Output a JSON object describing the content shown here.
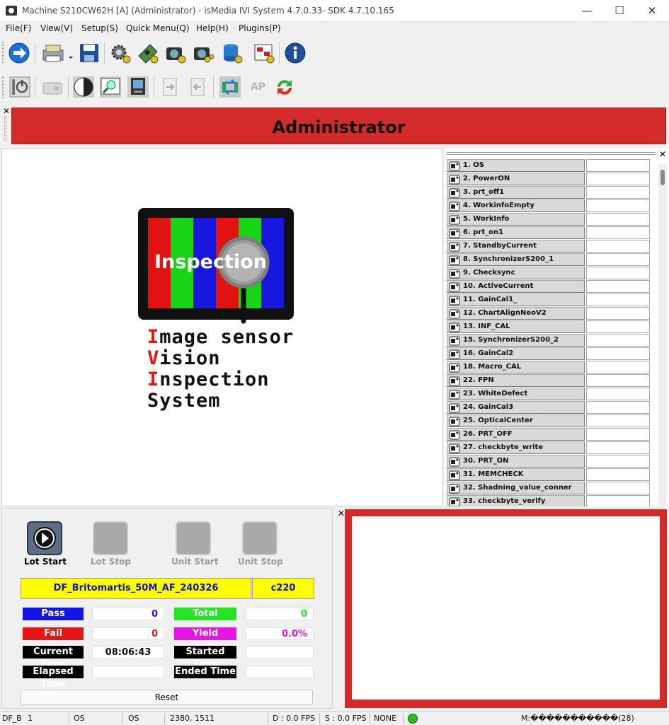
{
  "window": {
    "title": "Machine S210CW62H [A] (Administrator) - isMedia IVI System 4.7.0.33- SDK 4.7.10.165",
    "minimize": "—",
    "maximize": "☐",
    "close": "✕"
  },
  "menu": [
    "File(F)",
    "View(V)",
    "Setup(S)",
    "Quick Menu(Q)",
    "Help(H)",
    "Plugins(P)"
  ],
  "toolbar2": {
    "ap_label": "AP"
  },
  "admin_banner": "Administrator",
  "logo": {
    "screen_text": "Inspection",
    "lines": [
      {
        "first": "I",
        "rest": "mage sensor"
      },
      {
        "first": "V",
        "rest": "ision"
      },
      {
        "first": "I",
        "rest": "nspection"
      },
      {
        "first": "",
        "rest": "System"
      }
    ]
  },
  "steps": [
    "1. OS",
    "2. PowerON",
    "3. prt_off1",
    "4. WorkinfoEmpty",
    "5. WorkInfo",
    "6. prt_on1",
    "7. StandbyCurrent",
    "8. SynchronizerS200_1",
    "9. Checksync",
    "10. ActiveCurrent",
    "11. GainCal1_",
    "12. ChartAlignNeoV2",
    "13. INF_CAL",
    "15. SynchronizerS200_2",
    "16. GainCal2",
    "18. Macro_CAL",
    "22. FPN",
    "23. WhiteDefect",
    "24. GainCal3",
    "25. OpticalCenter",
    "26. PRT_OFF",
    "27. checkbyte_write",
    "30. PRT_ON",
    "31. MEMCHECK",
    "32. Shadning_value_conner",
    "33. checkbyte_verify"
  ],
  "controls": {
    "lot_start": "Lot Start",
    "lot_stop": "Lot Stop",
    "unit_start": "Unit Start",
    "unit_stop": "Unit Stop",
    "model": "DF_Britomartis_50M_AF_240326",
    "code": "c220",
    "pass_label": "Pass",
    "pass_value": "0",
    "total_label": "Total",
    "total_value": "0",
    "fail_label": "Fail",
    "fail_value": "0",
    "yield_label": "Yield",
    "yield_value": "0.0%",
    "current_time_label": "Current Time",
    "current_time_value": "08:06:43",
    "started_time_label": "Started Time",
    "started_time_value": "",
    "elapsed_time_label": "Elapsed Time",
    "elapsed_time_value": "",
    "ended_time_label": "Ended Time",
    "ended_time_value": "",
    "reset": "Reset"
  },
  "colors": {
    "banner_red": "#d32a2a",
    "pass_blue": "#1414e6",
    "total_green": "#22e622",
    "fail_red": "#e61414",
    "yield_magenta": "#e614e6",
    "model_yellow": "#ffff00"
  },
  "status": {
    "s1": "DF_B",
    "s2": "1",
    "s3": "OS",
    "s4": "OS",
    "s5": "2380, 1511",
    "s6": "D : 0.0 FPS",
    "s7": "S : 0.0 FPS",
    "s8": "NONE",
    "s9": "M:�����������(28)"
  },
  "icons": [
    "arrow-right-icon",
    "printer-icon",
    "save-icon",
    "gear-icon",
    "board-icon",
    "camera-gear-icon",
    "camera-gears-icon",
    "database-icon",
    "chart-gear-icon",
    "info-icon",
    "power-icon",
    "hdd-icon",
    "contrast-icon",
    "zoom-image-icon",
    "monitor-icon",
    "export-icon",
    "import-icon",
    "sync-icon",
    "refresh-icon"
  ]
}
